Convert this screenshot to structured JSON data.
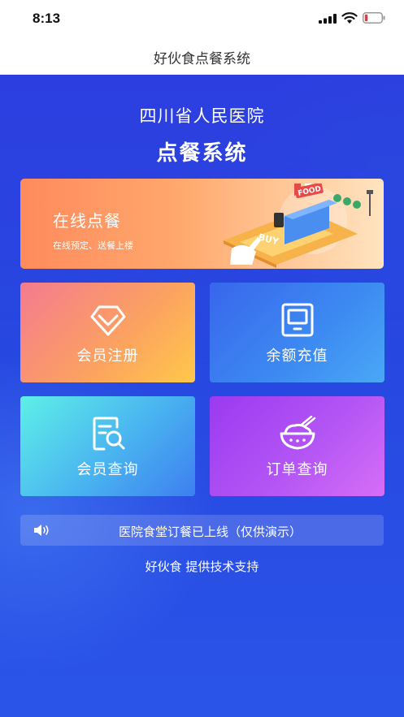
{
  "status_bar": {
    "time": "8:13"
  },
  "nav": {
    "title": "好伙食点餐系统"
  },
  "header": {
    "hospital": "四川省人民医院",
    "system": "点餐系统"
  },
  "banner": {
    "title": "在线点餐",
    "subtitle": "在线预定、送餐上楼",
    "sign_text": "FOOD",
    "phone_text": "BUY"
  },
  "tiles": [
    {
      "label": "会员注册",
      "icon": "diamond-icon"
    },
    {
      "label": "余额充值",
      "icon": "card-icon"
    },
    {
      "label": "会员查询",
      "icon": "search-document-icon"
    },
    {
      "label": "订单查询",
      "icon": "rice-bowl-icon"
    }
  ],
  "notice": {
    "text": "医院食堂订餐已上线（仅供演示）",
    "icon": "speaker-icon"
  },
  "footer": {
    "text": "好伙食 提供技术支持"
  },
  "colors": {
    "background": "#2b45e0",
    "banner": "#ff9a63",
    "tile_register": "#f9926a",
    "tile_recharge": "#3d7bf0",
    "tile_query": "#4fc6f0",
    "tile_orders": "#b04ef5"
  }
}
